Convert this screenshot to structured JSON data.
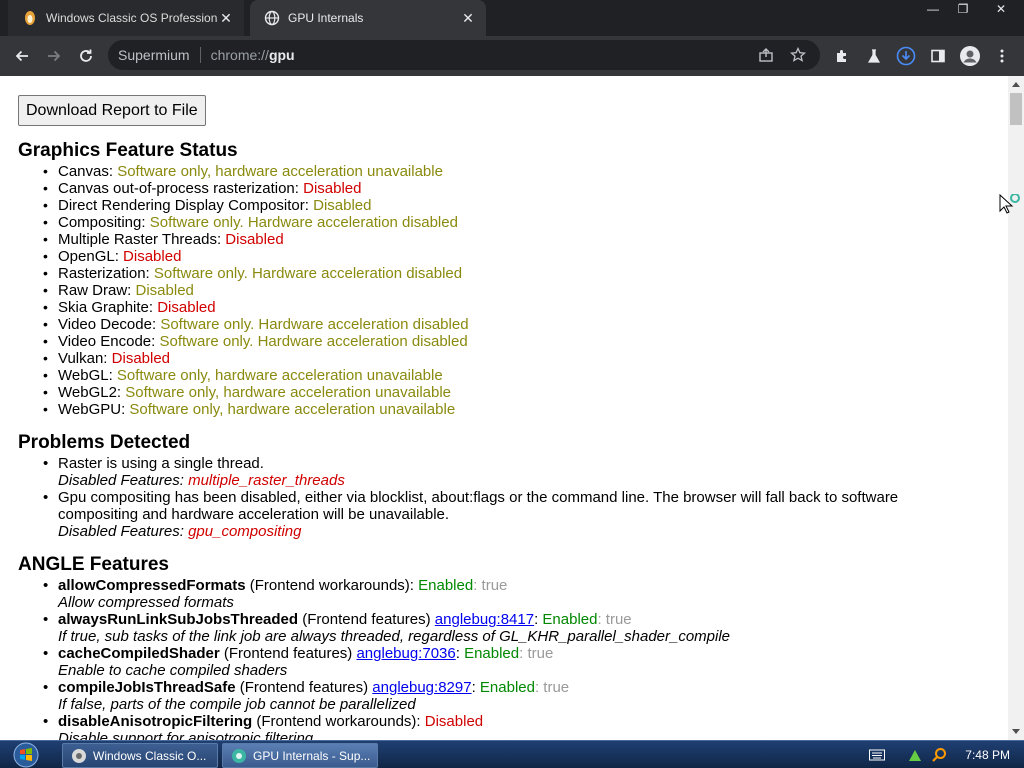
{
  "window": {
    "tabs": [
      {
        "title": "Windows Classic OS Professional",
        "active": false
      },
      {
        "title": "GPU Internals",
        "active": true
      }
    ],
    "controls": {
      "minimize": "—",
      "restore": "❐",
      "close": "✕"
    }
  },
  "toolbar": {
    "site_label": "Supermium",
    "url_scheme": "chrome://",
    "url_host": "gpu"
  },
  "page": {
    "download_button": "Download Report to File",
    "graphics_title": "Graphics Feature Status",
    "graphics_features": [
      {
        "name": "Canvas: ",
        "status": "Software only, hardware acceleration unavailable",
        "level": "soft"
      },
      {
        "name": "Canvas out-of-process rasterization: ",
        "status": "Disabled",
        "level": "off"
      },
      {
        "name": "Direct Rendering Display Compositor: ",
        "status": "Disabled",
        "level": "soft"
      },
      {
        "name": "Compositing: ",
        "status": "Software only. Hardware acceleration disabled",
        "level": "soft"
      },
      {
        "name": "Multiple Raster Threads: ",
        "status": "Disabled",
        "level": "off"
      },
      {
        "name": "OpenGL: ",
        "status": "Disabled",
        "level": "off"
      },
      {
        "name": "Rasterization: ",
        "status": "Software only. Hardware acceleration disabled",
        "level": "soft"
      },
      {
        "name": "Raw Draw: ",
        "status": "Disabled",
        "level": "soft"
      },
      {
        "name": "Skia Graphite: ",
        "status": "Disabled",
        "level": "off"
      },
      {
        "name": "Video Decode: ",
        "status": "Software only. Hardware acceleration disabled",
        "level": "soft"
      },
      {
        "name": "Video Encode: ",
        "status": "Software only. Hardware acceleration disabled",
        "level": "soft"
      },
      {
        "name": "Vulkan: ",
        "status": "Disabled",
        "level": "off"
      },
      {
        "name": "WebGL: ",
        "status": "Software only, hardware acceleration unavailable",
        "level": "soft"
      },
      {
        "name": "WebGL2: ",
        "status": "Software only, hardware acceleration unavailable",
        "level": "soft"
      },
      {
        "name": "WebGPU: ",
        "status": "Software only, hardware acceleration unavailable",
        "level": "soft"
      }
    ],
    "problems_title": "Problems Detected",
    "problems": {
      "p1_text": "Raster is using a single thread.",
      "p1_disabled_label": "Disabled Features: ",
      "p1_disabled_value": "multiple_raster_threads",
      "p2_text": "Gpu compositing has been disabled, either via blocklist, about:flags or the command line. The browser will fall back to software compositing and hardware acceleration will be unavailable.",
      "p2_disabled_label": "Disabled Features: ",
      "p2_disabled_value": "gpu_compositing"
    },
    "angle_title": "ANGLE Features",
    "angle_features": {
      "f1_name": "allowCompressedFormats",
      "f1_cat": " (Frontend workarounds): ",
      "f1_state": "Enabled",
      "f1_val": ": true",
      "f1_desc": "Allow compressed formats",
      "f2_name": "alwaysRunLinkSubJobsThreaded",
      "f2_cat": " (Frontend features) ",
      "f2_link": "anglebug:8417",
      "f2_state": "Enabled",
      "f2_val": ": true",
      "f2_desc": "If true, sub tasks of the link job are always threaded, regardless of GL_KHR_parallel_shader_compile",
      "f3_name": "cacheCompiledShader",
      "f3_cat": " (Frontend features) ",
      "f3_link": "anglebug:7036",
      "f3_state": "Enabled",
      "f3_val": ": true",
      "f3_desc": "Enable to cache compiled shaders",
      "f4_name": "compileJobIsThreadSafe",
      "f4_cat": " (Frontend features) ",
      "f4_link": "anglebug:8297",
      "f4_state": "Enabled",
      "f4_val": ": true",
      "f4_desc": "If false, parts of the compile job cannot be parallelized",
      "f5_name": "disableAnisotropicFiltering",
      "f5_cat": " (Frontend workarounds): ",
      "f5_state": "Disabled",
      "f5_desc": "Disable support for anisotropic filtering"
    }
  },
  "taskbar": {
    "tasks": [
      {
        "label": "Windows Classic O...",
        "active": false
      },
      {
        "label": "GPU Internals - Sup...",
        "active": true
      }
    ],
    "clock": "7:48 PM"
  },
  "colors": {
    "software_only": "#8a8a0f",
    "disabled": "#d10000",
    "enabled": "#008800",
    "link": "#0000ee"
  }
}
